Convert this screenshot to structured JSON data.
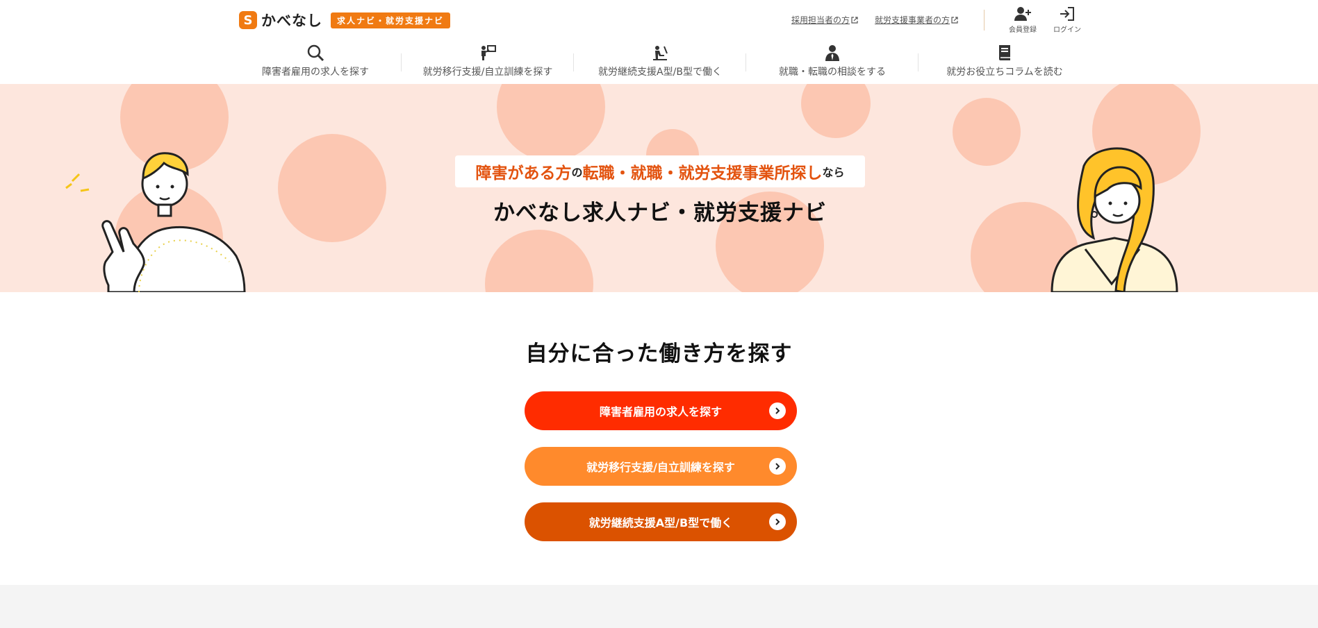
{
  "header": {
    "logo_text": "かべなし",
    "logo_badge": "求人ナビ・就労支援ナビ",
    "top_links": [
      "採用担当者の方",
      "就労支援事業者の方"
    ],
    "register_label": "会員登録",
    "login_label": "ログイン"
  },
  "nav": [
    {
      "label": "障害者雇用の求人を探す",
      "icon": "search-icon"
    },
    {
      "label": "就労移行支援/自立訓練を探す",
      "icon": "training-icon"
    },
    {
      "label": "就労継続支援A型/B型で働く",
      "icon": "work-icon"
    },
    {
      "label": "就職・転職の相談をする",
      "icon": "consult-icon"
    },
    {
      "label": "就労お役立ちコラムを読む",
      "icon": "book-icon"
    }
  ],
  "hero": {
    "catch_part1": "障害がある方",
    "catch_part2": "の",
    "catch_part3": "転職・就職・就労支援事業所探し",
    "catch_part4": "なら",
    "title": "かべなし求人ナビ・就労支援ナビ"
  },
  "main": {
    "title": "自分に合った働き方を探す",
    "cta": [
      "障害者雇用の求人を探す",
      "就労移行支援/自立訓練を探す",
      "就労継続支援A型/B型で働く"
    ]
  },
  "colors": {
    "brand": "#f07a12",
    "hero_bg": "#fde6dd",
    "hero_circle": "#fcc7b2",
    "cta_red": "#ff2c00",
    "cta_orange": "#ff8a2c",
    "cta_dark_orange": "#db5200"
  }
}
